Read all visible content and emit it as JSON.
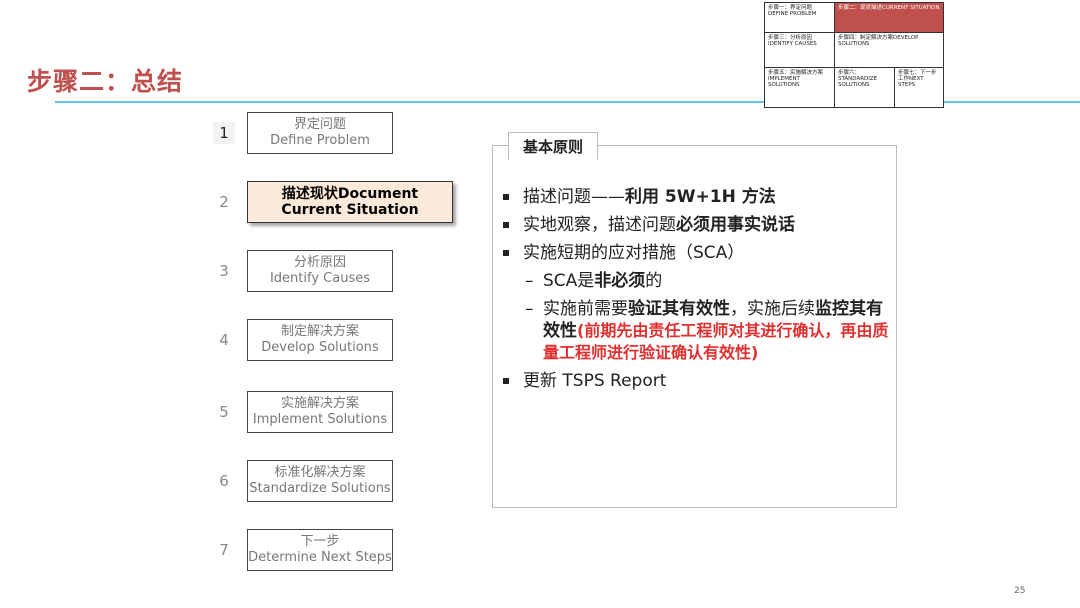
{
  "title": "步骤二：总结",
  "step_map": {
    "s1": "步骤一：界定问题 DEFINE PROBLEM",
    "s2": "步骤二：现状描述CURRENT SITUATION",
    "s3": "步骤三：分析原因 IDENTIFY CAUSES",
    "s4": "步骤四：制定解决方案DEVELOP SOLUTIONS",
    "s5": "步骤五：实施解决方案IMPLEMENT SOLUTIONS",
    "s6": "步骤六：STANDARDIZE SOLUTIONS",
    "s7": "步骤七：下一步工作NEXT STEPS"
  },
  "steps": [
    {
      "num": "1",
      "cn": "界定问题",
      "en": "Define Problem"
    },
    {
      "num": "2",
      "cn": "描述现状Document",
      "en": "Current Situation"
    },
    {
      "num": "3",
      "cn": "分析原因",
      "en": "Identify Causes"
    },
    {
      "num": "4",
      "cn": "制定解决方案",
      "en": "Develop Solutions"
    },
    {
      "num": "5",
      "cn": "实施解决方案",
      "en": "Implement Solutions"
    },
    {
      "num": "6",
      "cn": "标准化解决方案",
      "en": "Standardize Solutions"
    },
    {
      "num": "7",
      "cn": "下一步",
      "en": "Determine Next Steps"
    }
  ],
  "panel": {
    "tag": "基本原则",
    "p1_a": "描述问题——",
    "p1_b": "利用 5W+1H 方法",
    "p2_a": "实地观察，描述问题",
    "p2_b": "必须用事实说话",
    "p3": "实施短期的应对措施（SCA）",
    "p3_s1_a": "SCA是",
    "p3_s1_b": "非必须",
    "p3_s1_c": "的",
    "p3_s2_a": "实施前需要",
    "p3_s2_b": "验证其有效性",
    "p3_s2_c": "，实施后续",
    "p3_s2_d": "监控其有效性",
    "p3_s2_e": "(前期先由责任工程师对其进行确认，再由质量工程师进行验证确认有效性)",
    "p4": "更新 TSPS Report"
  },
  "page_number": "25"
}
